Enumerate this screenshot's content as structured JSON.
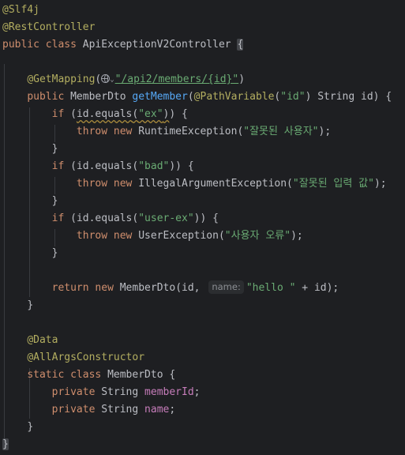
{
  "code": {
    "ann_slf4j": "@Slf4j",
    "ann_rest": "@RestController",
    "kw_public": "public",
    "kw_class": "class",
    "kw_if": "if",
    "kw_throw": "throw",
    "kw_new": "new",
    "kw_return": "return",
    "kw_static": "static",
    "kw_private": "private",
    "class_name": "ApiExceptionV2Controller",
    "ann_getmapping": "@GetMapping",
    "url": "\"/api2/members/{id}\"",
    "type_member_dto": "MemberDto",
    "method_get_member": "getMember",
    "ann_pathvariable": "@PathVariable",
    "str_id": "\"id\"",
    "type_string": "String",
    "param_id": "id",
    "id_equals": "id.equals",
    "str_ex": "\"ex\"",
    "str_bad": "\"bad\"",
    "str_user_ex": "\"user-ex\"",
    "runtime_exception": "RuntimeException",
    "illegal_argument_exception": "IllegalArgumentException",
    "user_exception": "UserException",
    "msg_wrong_user": "\"잘못된 사용자\"",
    "msg_wrong_input": "\"잘못된 입력 값\"",
    "msg_user_error": "\"사용자 오류\"",
    "hint_name": "name:",
    "str_hello": "\"hello \"",
    "ann_data": "@Data",
    "ann_all_args": "@AllArgsConstructor",
    "field_member_id": "memberId",
    "field_name": "name",
    "open_brace": "{",
    "close_brace": "}"
  },
  "icons": [
    "globe-icon",
    "chevron-down-icon"
  ],
  "colors": {
    "background": "#1e1f22",
    "keyword": "#cf8e6d",
    "annotation": "#b3ae60",
    "string": "#6aab73",
    "method": "#56a8f5",
    "field": "#c77dbb",
    "default": "#bcbec4"
  }
}
